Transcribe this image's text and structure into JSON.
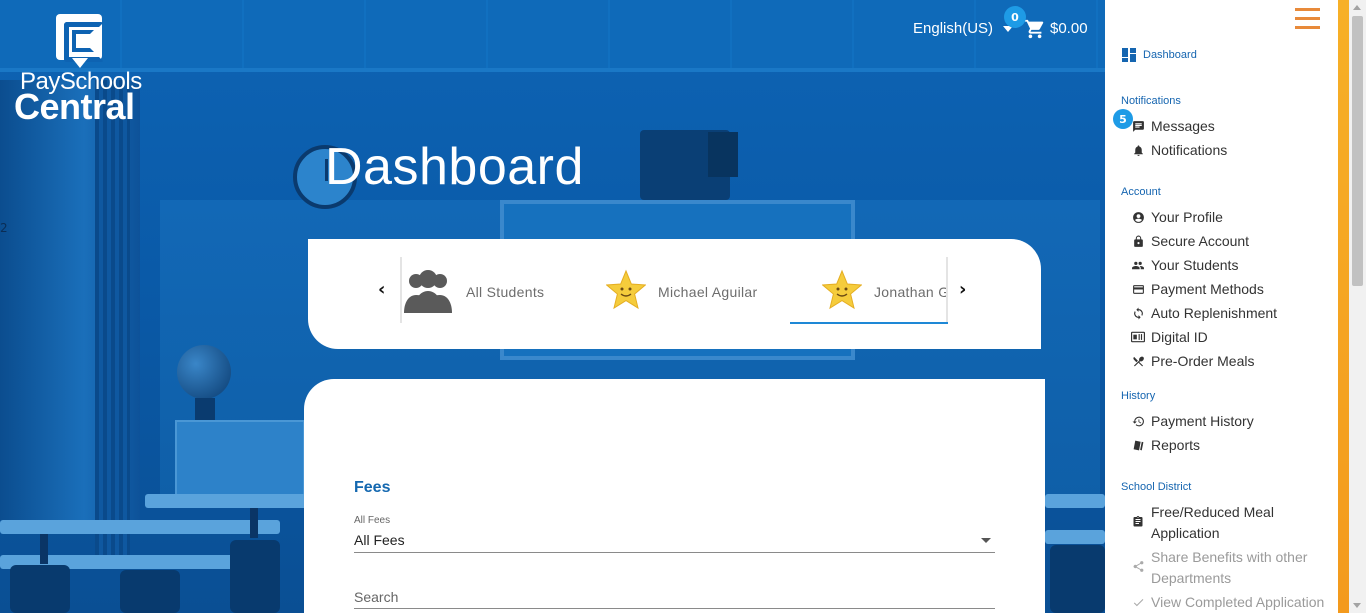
{
  "stray_text": "2",
  "brand": {
    "line1": "PaySchools",
    "line2": "Central"
  },
  "header": {
    "language": "English(US)",
    "cart_count": "0",
    "cart_total": "$0.00"
  },
  "page_title": "Dashboard",
  "students": [
    {
      "name": "All Students",
      "icon": "group-icon",
      "active": false
    },
    {
      "name": "Michael  Aguilar",
      "icon": "star-avatar-icon",
      "active": false
    },
    {
      "name": "Jonathan  Gonzalez",
      "icon": "star-avatar-icon",
      "active": true
    }
  ],
  "fees": {
    "title": "Fees",
    "filter_label": "All Fees",
    "filter_value": "All Fees",
    "search_placeholder": "Search"
  },
  "sidebar": {
    "dashboard": "Dashboard",
    "messages_badge": "5",
    "sections": [
      {
        "title": "Notifications",
        "items": [
          {
            "label": "Messages",
            "icon": "message-icon"
          },
          {
            "label": "Notifications",
            "icon": "bell-icon"
          }
        ]
      },
      {
        "title": "Account",
        "items": [
          {
            "label": "Your Profile",
            "icon": "profile-icon"
          },
          {
            "label": "Secure Account",
            "icon": "lock-icon"
          },
          {
            "label": "Your Students",
            "icon": "students-icon"
          },
          {
            "label": "Payment Methods",
            "icon": "card-icon"
          },
          {
            "label": "Auto Replenishment",
            "icon": "refresh-icon"
          },
          {
            "label": "Digital ID",
            "icon": "id-card-icon"
          },
          {
            "label": "Pre-Order Meals",
            "icon": "utensils-icon"
          }
        ]
      },
      {
        "title": "History",
        "items": [
          {
            "label": "Payment History",
            "icon": "history-icon"
          },
          {
            "label": "Reports",
            "icon": "reports-icon"
          }
        ]
      },
      {
        "title": "School District",
        "items": [
          {
            "label": "Free/Reduced Meal Application",
            "icon": "clipboard-icon"
          },
          {
            "label": "Share Benefits with other Departments",
            "icon": "share-icon"
          },
          {
            "label": "View Completed Application",
            "icon": "check-icon"
          }
        ]
      }
    ]
  },
  "colors": {
    "accent": "#1565b0",
    "orange": "#f39a1d",
    "badge": "#1e9be6",
    "hero": "#0b5aa6"
  }
}
